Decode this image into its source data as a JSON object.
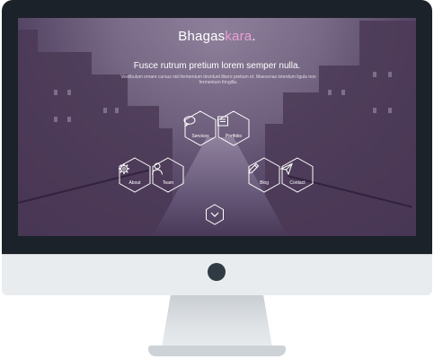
{
  "brand": {
    "name_main": "Bhagas",
    "name_accent": "kara",
    "name_dot": "."
  },
  "hero": {
    "tagline": "Fusce rutrum pretium lorem semper nulla.",
    "description": "Vestibulum ornare cursus nisl fermentum tincidunt libero pretium et. Maecenas interdum ligula non fermentum fringilla."
  },
  "nav": {
    "services": "Services",
    "portfolio": "Portfolio",
    "about": "About",
    "team": "Team",
    "blog": "Blog",
    "contact": "Contact"
  },
  "colors": {
    "accent": "#e9a1d4",
    "bezel": "#1c2229",
    "chin": "#e9ecef"
  },
  "icons": {
    "services": "speech-bubble-icon",
    "portfolio": "briefcase-icon",
    "about": "gear-icon",
    "team": "person-icon",
    "blog": "pencil-icon",
    "contact": "paper-plane-icon",
    "scroll": "chevron-down-icon"
  }
}
